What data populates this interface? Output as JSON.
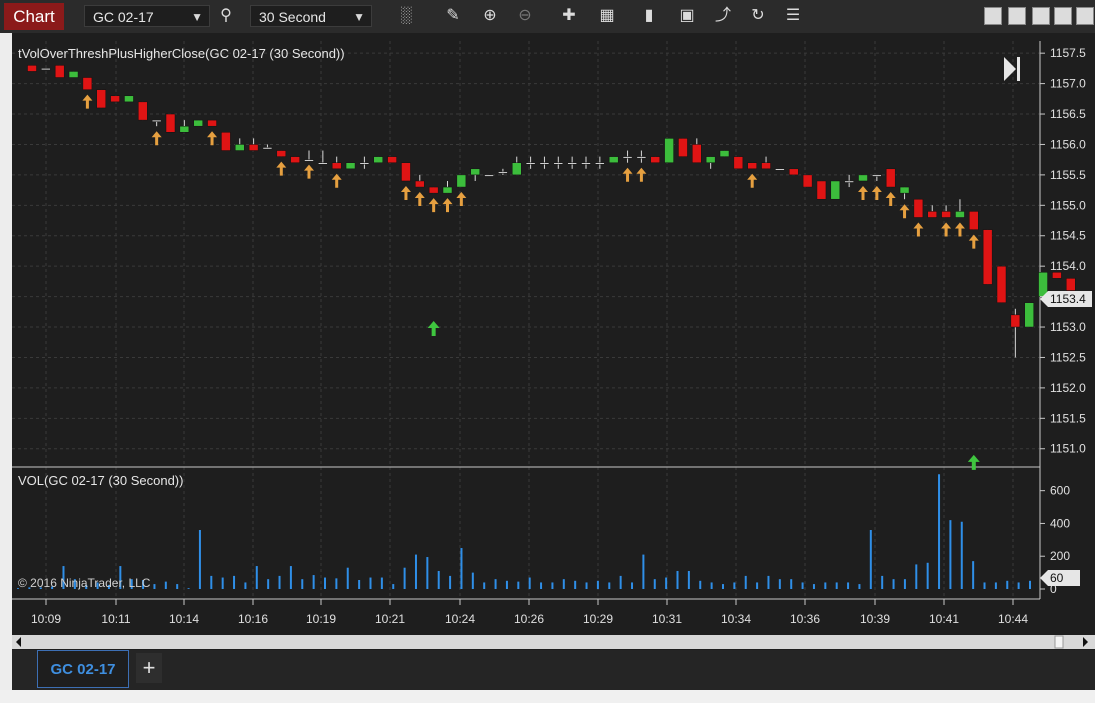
{
  "toolbar": {
    "chart_tab": "Chart",
    "instrument": "GC 02-17",
    "interval": "30 Second",
    "icons": [
      "search-icon",
      "bar-type-icon",
      "draw-pencil-icon",
      "zoom-in-icon",
      "zoom-out-icon",
      "crosshair-icon",
      "data-box-icon",
      "strategy-icon",
      "indicators-icon",
      "draw-tools-icon",
      "reload-icon",
      "properties-icon"
    ]
  },
  "panels": {
    "price_title": "tVolOverThreshPlusHigherClose(GC 02-17 (30 Second))",
    "volume_title": "VOL(GC 02-17 (30 Second))",
    "copyright": "© 2016 NinjaTrader, LLC",
    "current_price_label": "1153.4",
    "current_volume_label": "60"
  },
  "tabs": {
    "document_tab": "GC 02-17",
    "add_tab": "+"
  },
  "colors": {
    "up": "#3cbd3c",
    "down": "#e01414",
    "arrow": "#e6a040",
    "volume": "#2f8fe8",
    "signal": "#3fc63f",
    "background": "#1e1e1e",
    "grid": "#3a3a3a"
  },
  "chart_data": [
    {
      "type": "candlestick",
      "title": "tVolOverThreshPlusHigherClose(GC 02-17 (30 Second))",
      "ylim": [
        1150.7,
        1157.7
      ],
      "y_ticks": [
        "1157.5",
        "1157.0",
        "1156.5",
        "1156.0",
        "1155.5",
        "1155.0",
        "1154.5",
        "1154.0",
        "1153.5",
        "1153.0",
        "1152.5",
        "1152.0",
        "1151.5",
        "1151.0"
      ],
      "x_ticks": [
        "10:09",
        "10:11",
        "10:14",
        "10:16",
        "10:19",
        "10:21",
        "10:24",
        "10:26",
        "10:29",
        "10:31",
        "10:34",
        "10:36",
        "10:39",
        "10:41",
        "10:44"
      ],
      "candles": [
        {
          "o": 1157.3,
          "h": 1157.3,
          "l": 1157.2,
          "c": 1157.2
        },
        {
          "o": 1157.25,
          "h": 1157.25,
          "l": 1157.25,
          "c": 1157.25
        },
        {
          "o": 1157.3,
          "h": 1157.3,
          "l": 1157.1,
          "c": 1157.1
        },
        {
          "o": 1157.1,
          "h": 1157.2,
          "l": 1157.1,
          "c": 1157.2
        },
        {
          "o": 1157.1,
          "h": 1157.1,
          "l": 1156.9,
          "c": 1156.9
        },
        {
          "o": 1156.9,
          "h": 1156.9,
          "l": 1156.6,
          "c": 1156.6
        },
        {
          "o": 1156.8,
          "h": 1156.8,
          "l": 1156.7,
          "c": 1156.7
        },
        {
          "o": 1156.7,
          "h": 1156.7,
          "l": 1156.7,
          "c": 1156.8
        },
        {
          "o": 1156.7,
          "h": 1156.7,
          "l": 1156.4,
          "c": 1156.4
        },
        {
          "o": 1156.4,
          "h": 1156.4,
          "l": 1156.3,
          "c": 1156.4
        },
        {
          "o": 1156.5,
          "h": 1156.5,
          "l": 1156.2,
          "c": 1156.2
        },
        {
          "o": 1156.2,
          "h": 1156.4,
          "l": 1156.2,
          "c": 1156.3
        },
        {
          "o": 1156.3,
          "h": 1156.4,
          "l": 1156.3,
          "c": 1156.4
        },
        {
          "o": 1156.4,
          "h": 1156.4,
          "l": 1156.3,
          "c": 1156.3
        },
        {
          "o": 1156.2,
          "h": 1156.2,
          "l": 1155.9,
          "c": 1155.9
        },
        {
          "o": 1155.9,
          "h": 1156.1,
          "l": 1155.9,
          "c": 1156.0
        },
        {
          "o": 1156.0,
          "h": 1156.1,
          "l": 1155.9,
          "c": 1155.9
        },
        {
          "o": 1155.95,
          "h": 1156.0,
          "l": 1155.95,
          "c": 1155.95
        },
        {
          "o": 1155.9,
          "h": 1155.9,
          "l": 1155.8,
          "c": 1155.8
        },
        {
          "o": 1155.8,
          "h": 1155.8,
          "l": 1155.7,
          "c": 1155.7
        },
        {
          "o": 1155.75,
          "h": 1155.9,
          "l": 1155.75,
          "c": 1155.75
        },
        {
          "o": 1155.7,
          "h": 1155.9,
          "l": 1155.7,
          "c": 1155.7
        },
        {
          "o": 1155.7,
          "h": 1155.8,
          "l": 1155.6,
          "c": 1155.6
        },
        {
          "o": 1155.6,
          "h": 1155.7,
          "l": 1155.6,
          "c": 1155.7
        },
        {
          "o": 1155.7,
          "h": 1155.8,
          "l": 1155.6,
          "c": 1155.7
        },
        {
          "o": 1155.7,
          "h": 1155.8,
          "l": 1155.7,
          "c": 1155.8
        },
        {
          "o": 1155.8,
          "h": 1155.8,
          "l": 1155.7,
          "c": 1155.7
        },
        {
          "o": 1155.7,
          "h": 1155.7,
          "l": 1155.4,
          "c": 1155.4
        },
        {
          "o": 1155.4,
          "h": 1155.5,
          "l": 1155.3,
          "c": 1155.3
        },
        {
          "o": 1155.3,
          "h": 1155.3,
          "l": 1155.2,
          "c": 1155.2
        },
        {
          "o": 1155.2,
          "h": 1155.4,
          "l": 1155.2,
          "c": 1155.3
        },
        {
          "o": 1155.3,
          "h": 1155.5,
          "l": 1155.3,
          "c": 1155.5
        },
        {
          "o": 1155.5,
          "h": 1155.6,
          "l": 1155.4,
          "c": 1155.6
        },
        {
          "o": 1155.5,
          "h": 1155.5,
          "l": 1155.5,
          "c": 1155.5
        },
        {
          "o": 1155.55,
          "h": 1155.6,
          "l": 1155.5,
          "c": 1155.55
        },
        {
          "o": 1155.5,
          "h": 1155.8,
          "l": 1155.5,
          "c": 1155.7
        },
        {
          "o": 1155.7,
          "h": 1155.8,
          "l": 1155.6,
          "c": 1155.7
        },
        {
          "o": 1155.7,
          "h": 1155.8,
          "l": 1155.6,
          "c": 1155.7
        },
        {
          "o": 1155.7,
          "h": 1155.8,
          "l": 1155.6,
          "c": 1155.7
        },
        {
          "o": 1155.7,
          "h": 1155.8,
          "l": 1155.6,
          "c": 1155.7
        },
        {
          "o": 1155.7,
          "h": 1155.8,
          "l": 1155.6,
          "c": 1155.7
        },
        {
          "o": 1155.7,
          "h": 1155.8,
          "l": 1155.6,
          "c": 1155.7
        },
        {
          "o": 1155.7,
          "h": 1155.8,
          "l": 1155.7,
          "c": 1155.8
        },
        {
          "o": 1155.8,
          "h": 1155.9,
          "l": 1155.7,
          "c": 1155.8
        },
        {
          "o": 1155.8,
          "h": 1155.9,
          "l": 1155.7,
          "c": 1155.8
        },
        {
          "o": 1155.8,
          "h": 1155.8,
          "l": 1155.7,
          "c": 1155.7
        },
        {
          "o": 1155.7,
          "h": 1156.1,
          "l": 1155.7,
          "c": 1156.1
        },
        {
          "o": 1156.1,
          "h": 1156.1,
          "l": 1155.8,
          "c": 1155.8
        },
        {
          "o": 1156.0,
          "h": 1156.1,
          "l": 1155.7,
          "c": 1155.7
        },
        {
          "o": 1155.7,
          "h": 1155.8,
          "l": 1155.6,
          "c": 1155.8
        },
        {
          "o": 1155.8,
          "h": 1155.9,
          "l": 1155.8,
          "c": 1155.9
        },
        {
          "o": 1155.8,
          "h": 1155.8,
          "l": 1155.6,
          "c": 1155.6
        },
        {
          "o": 1155.7,
          "h": 1155.7,
          "l": 1155.6,
          "c": 1155.6
        },
        {
          "o": 1155.7,
          "h": 1155.8,
          "l": 1155.6,
          "c": 1155.6
        },
        {
          "o": 1155.6,
          "h": 1155.6,
          "l": 1155.6,
          "c": 1155.6
        },
        {
          "o": 1155.6,
          "h": 1155.6,
          "l": 1155.5,
          "c": 1155.5
        },
        {
          "o": 1155.5,
          "h": 1155.5,
          "l": 1155.3,
          "c": 1155.3
        },
        {
          "o": 1155.4,
          "h": 1155.4,
          "l": 1155.1,
          "c": 1155.1
        },
        {
          "o": 1155.1,
          "h": 1155.4,
          "l": 1155.1,
          "c": 1155.4
        },
        {
          "o": 1155.4,
          "h": 1155.5,
          "l": 1155.3,
          "c": 1155.4
        },
        {
          "o": 1155.4,
          "h": 1155.5,
          "l": 1155.4,
          "c": 1155.5
        },
        {
          "o": 1155.5,
          "h": 1155.5,
          "l": 1155.4,
          "c": 1155.5
        },
        {
          "o": 1155.6,
          "h": 1155.6,
          "l": 1155.3,
          "c": 1155.3
        },
        {
          "o": 1155.2,
          "h": 1155.3,
          "l": 1155.1,
          "c": 1155.3
        },
        {
          "o": 1155.1,
          "h": 1155.1,
          "l": 1154.8,
          "c": 1154.8
        },
        {
          "o": 1154.9,
          "h": 1155.0,
          "l": 1154.8,
          "c": 1154.8
        },
        {
          "o": 1154.9,
          "h": 1155.0,
          "l": 1154.8,
          "c": 1154.8
        },
        {
          "o": 1154.8,
          "h": 1155.1,
          "l": 1154.8,
          "c": 1154.9
        },
        {
          "o": 1154.9,
          "h": 1154.9,
          "l": 1154.6,
          "c": 1154.6
        },
        {
          "o": 1154.6,
          "h": 1154.6,
          "l": 1153.7,
          "c": 1153.7
        },
        {
          "o": 1154.0,
          "h": 1154.0,
          "l": 1153.4,
          "c": 1153.4
        },
        {
          "o": 1153.2,
          "h": 1153.3,
          "l": 1152.5,
          "c": 1153.0
        },
        {
          "o": 1153.0,
          "h": 1153.4,
          "l": 1153.0,
          "c": 1153.4
        },
        {
          "o": 1153.5,
          "h": 1153.9,
          "l": 1153.5,
          "c": 1153.9
        },
        {
          "o": 1153.9,
          "h": 1153.9,
          "l": 1153.8,
          "c": 1153.8
        },
        {
          "o": 1153.8,
          "h": 1153.8,
          "l": 1153.6,
          "c": 1153.6
        },
        {
          "o": 1153.5,
          "h": 1153.5,
          "l": 1153.4,
          "c": 1153.4
        }
      ],
      "arrow_up_signals_below_bar": [
        4,
        9,
        13,
        18,
        20,
        22,
        27,
        28,
        29,
        30,
        31,
        43,
        44,
        52,
        60,
        61,
        62,
        63,
        64,
        66,
        67,
        68
      ],
      "green_signal_arrows": [
        {
          "bar": 29,
          "y": 1153.1
        },
        {
          "bar": 68,
          "y": 1150.9
        }
      ]
    },
    {
      "type": "bar",
      "title": "VOL(GC 02-17 (30 Second))",
      "ylim": [
        0,
        720
      ],
      "y_ticks": [
        "600",
        "400",
        "200",
        "0"
      ],
      "values": [
        5,
        10,
        10,
        15,
        140,
        60,
        25,
        40,
        25,
        140,
        60,
        55,
        30,
        45,
        30,
        5,
        360,
        80,
        70,
        80,
        40,
        140,
        60,
        80,
        140,
        60,
        85,
        70,
        65,
        130,
        55,
        70,
        70,
        30,
        130,
        210,
        195,
        110,
        80,
        250,
        100,
        40,
        60,
        50,
        45,
        70,
        40,
        40,
        60,
        50,
        40,
        50,
        40,
        80,
        40,
        210,
        60,
        70,
        110,
        110,
        50,
        40,
        30,
        40,
        80,
        40,
        80,
        60,
        60,
        40,
        30,
        40,
        40,
        40,
        30,
        360,
        80,
        60,
        60,
        150,
        160,
        700,
        420,
        410,
        170,
        40,
        40,
        50,
        40,
        50
      ]
    }
  ]
}
